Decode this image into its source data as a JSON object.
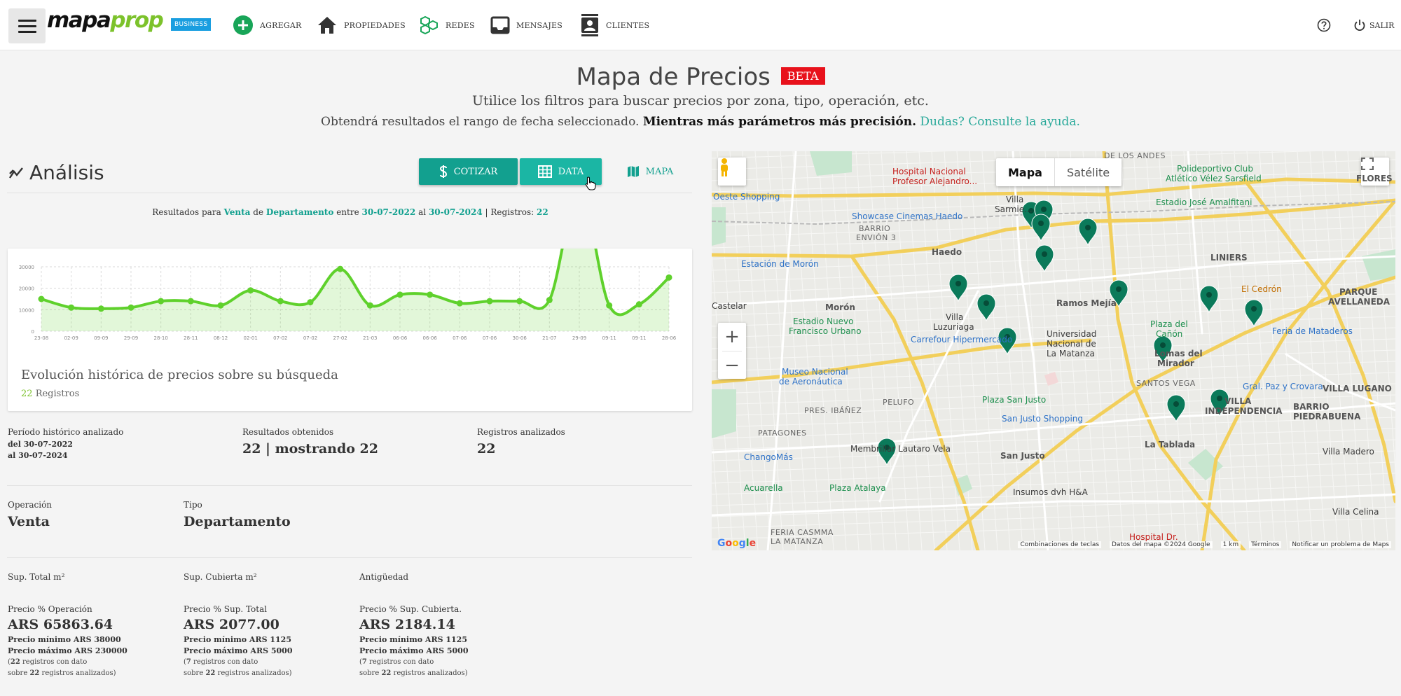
{
  "nav": {
    "logo_part1": "mapa",
    "logo_part2": "prop",
    "business_badge": "BUSINESS",
    "items": [
      {
        "label": "AGREGAR",
        "icon": "plus-circle-icon"
      },
      {
        "label": "PROPIEDADES",
        "icon": "home-icon"
      },
      {
        "label": "REDES",
        "icon": "network-icon"
      },
      {
        "label": "MENSAJES",
        "icon": "inbox-icon"
      },
      {
        "label": "CLIENTES",
        "icon": "contacts-icon"
      }
    ],
    "help_icon": "help-circle-icon",
    "logout_label": "SALIR",
    "logout_icon": "power-icon",
    "accent": "#7cc22b",
    "badge_color": "#1a9ee0"
  },
  "header": {
    "title": "Mapa de Precios",
    "beta": "BETA",
    "subtitle": "Utilice los filtros para buscar precios por zona, tipo, operación, etc.",
    "line2_plain": "Obtendrá resultados el rango de fecha seleccionado.",
    "line2_bold": "Mientras más parámetros más precisión.",
    "line2_link": "Dudas? Consulte la ayuda."
  },
  "analysis": {
    "title": "Análisis",
    "buttons": {
      "cotizar": "COTIZAR",
      "data": "DATA",
      "mapa": "MAPA"
    },
    "results": {
      "prefix": "Resultados para",
      "operation": "Venta",
      "de": "de",
      "type": "Departamento",
      "entre": "entre",
      "from": "30-07-2022",
      "al": "al",
      "to": "30-07-2024",
      "registros_label": "| Registros:",
      "registros": "22"
    },
    "card": {
      "title": "Evolución histórica de precios sobre su búsqueda",
      "count": "22",
      "count_label": "Registros"
    },
    "periodo": {
      "label": "Período histórico analizado",
      "from": "del 30-07-2022",
      "to": "al 30-07-2024"
    },
    "resultados": {
      "label": "Resultados obtenidos",
      "value": "22 | mostrando 22"
    },
    "registros": {
      "label": "Registros analizados",
      "value": "22"
    },
    "operacion": {
      "label": "Operación",
      "value": "Venta"
    },
    "tipo": {
      "label": "Tipo",
      "value": "Departamento"
    },
    "sup_total": {
      "label": "Sup. Total m²"
    },
    "sup_cubierta": {
      "label": "Sup. Cubierta m²"
    },
    "antiguedad": {
      "label": "Antigüedad"
    },
    "precio_op": {
      "label": "Precio % Operación",
      "value": "ARS 65863.64",
      "min": "Precio mínimo ARS 38000",
      "max": "Precio máximo ARS 230000",
      "note_open": "(",
      "note_count": "22",
      "note_mid": " registros con dato",
      "note_line2_a": "sobre ",
      "note_total": "22",
      "note_line2_b": " registros analizados)"
    },
    "precio_total": {
      "label": "Precio % Sup. Total",
      "value": "ARS 2077.00",
      "min": "Precio mínimo ARS 1125",
      "max": "Precio máximo ARS 5000",
      "note_open": "(",
      "note_count": "7",
      "note_mid": " registros con dato",
      "note_line2_a": "sobre ",
      "note_total": "22",
      "note_line2_b": " registros analizados)"
    },
    "precio_cubierta": {
      "label": "Precio % Sup. Cubierta.",
      "value": "ARS 2184.14",
      "min": "Precio mínimo ARS 1125",
      "max": "Precio máximo ARS 5000",
      "note_open": "(",
      "note_count": "7",
      "note_mid": " registros con dato",
      "note_line2_a": "sobre ",
      "note_total": "22",
      "note_line2_b": " registros analizados)"
    }
  },
  "chart_data": {
    "type": "area",
    "title": "",
    "x": [
      "23-08",
      "02-09",
      "09-09",
      "29-09",
      "28-10",
      "28-11",
      "08-12",
      "02-01",
      "07-02",
      "07-02",
      "27-02",
      "21-03",
      "06-06",
      "06-06",
      "07-06",
      "07-06",
      "30-06",
      "21-07",
      "29-09",
      "09-11",
      "09-11",
      "28-06"
    ],
    "values": [
      15000,
      11000,
      10500,
      11000,
      14000,
      14000,
      12000,
      19000,
      14000,
      13500,
      29000,
      12000,
      17000,
      17000,
      13000,
      14000,
      14000,
      14500,
      66000,
      12000,
      12500,
      25000
    ],
    "ylim": [
      0,
      30000
    ],
    "yticks": [
      0,
      10000,
      20000,
      30000
    ],
    "grid": true,
    "color": "#5fd12c"
  },
  "map": {
    "toggle": {
      "map": "Mapa",
      "satellite": "Satélite"
    },
    "zoom_in": "+",
    "zoom_out": "−",
    "labels": [
      {
        "text": "Hospital Nacional",
        "cls": "poi-red"
      },
      {
        "text": "Profesor Alejandro...",
        "cls": "poi-red"
      },
      {
        "text": "DE LOS ANDES",
        "cls": "area"
      },
      {
        "text": "Polideportivo Club",
        "cls": "poi-green"
      },
      {
        "text": "Atlético Vélez Sarsfield",
        "cls": "poi-green"
      },
      {
        "text": "FLORES",
        "cls": "bold"
      },
      {
        "text": "Oeste Shopping",
        "cls": "poi-blue"
      },
      {
        "text": "Villa",
        "cls": ""
      },
      {
        "text": "Sarmie...",
        "cls": ""
      },
      {
        "text": "Estadio José Amalfitani",
        "cls": "poi-green"
      },
      {
        "text": "Showcase Cinemas Haedo",
        "cls": "poi-blue"
      },
      {
        "text": "BARRIO",
        "cls": "area"
      },
      {
        "text": "ENVIÓN 3",
        "cls": "area"
      },
      {
        "text": "Haedo",
        "cls": "bold"
      },
      {
        "text": "LINIERS",
        "cls": "bold"
      },
      {
        "text": "Estación de Morón",
        "cls": "poi-blue"
      },
      {
        "text": "El Cedrón",
        "cls": "poi-orange"
      },
      {
        "text": "PARQUE",
        "cls": "bold"
      },
      {
        "text": "AVELLANEDA",
        "cls": "bold"
      },
      {
        "text": "Castelar",
        "cls": ""
      },
      {
        "text": "Morón",
        "cls": "bold"
      },
      {
        "text": "Ramos Mejía",
        "cls": "bold"
      },
      {
        "text": "Villa",
        "cls": ""
      },
      {
        "text": "Luzuriaga",
        "cls": ""
      },
      {
        "text": "Estadio Nuevo",
        "cls": "poi-green"
      },
      {
        "text": "Francisco Urbano",
        "cls": "poi-green"
      },
      {
        "text": "Carrefour Hipermercado",
        "cls": "poi-blue"
      },
      {
        "text": "Universidad",
        "cls": ""
      },
      {
        "text": "Nacional de",
        "cls": ""
      },
      {
        "text": "La Matanza",
        "cls": ""
      },
      {
        "text": "Plaza del",
        "cls": "poi-green"
      },
      {
        "text": "Cañón",
        "cls": "poi-green"
      },
      {
        "text": "Lomas del",
        "cls": "bold"
      },
      {
        "text": "Mirador",
        "cls": "bold"
      },
      {
        "text": "Feria de Mataderos",
        "cls": "poi-blue"
      },
      {
        "text": "Museo Nacional",
        "cls": "poi-blue"
      },
      {
        "text": "de Aeronáutica",
        "cls": "poi-blue"
      },
      {
        "text": "SANTOS VEGA",
        "cls": "area"
      },
      {
        "text": "Gral. Paz y Crovara",
        "cls": "poi-blue"
      },
      {
        "text": "VILLA LUGANO",
        "cls": "bold"
      },
      {
        "text": "PRES. IBÁÑEZ",
        "cls": "area"
      },
      {
        "text": "PELUFO",
        "cls": "area"
      },
      {
        "text": "Plaza San Justo",
        "cls": "poi-green"
      },
      {
        "text": "San Justo Shopping",
        "cls": "poi-blue"
      },
      {
        "text": "VILLA",
        "cls": "bold"
      },
      {
        "text": "INDEPENDENCIA",
        "cls": "bold"
      },
      {
        "text": "BARRIO",
        "cls": "bold"
      },
      {
        "text": "PIEDRABUENA",
        "cls": "bold"
      },
      {
        "text": "PATAGONES",
        "cls": "area"
      },
      {
        "text": "ChangoMás",
        "cls": "poi-blue"
      },
      {
        "text": "Membrillar Lautaro Vela",
        "cls": ""
      },
      {
        "text": "San Justo",
        "cls": "bold"
      },
      {
        "text": "La Tablada",
        "cls": "bold"
      },
      {
        "text": "Villa Madero",
        "cls": ""
      },
      {
        "text": "Acuarella",
        "cls": "poi-green"
      },
      {
        "text": "Plaza Atalaya",
        "cls": "poi-green"
      },
      {
        "text": "Insumos dvh H&A",
        "cls": ""
      },
      {
        "text": "Villa Celina",
        "cls": ""
      },
      {
        "text": "FERIA CASMMA",
        "cls": "area"
      },
      {
        "text": "LA MATANZA",
        "cls": "area"
      },
      {
        "text": "Hospital Dr.",
        "cls": "poi-red"
      }
    ],
    "footer": [
      "Combinaciones de teclas",
      "Datos del mapa ©2024 Google",
      "1 km",
      "Términos",
      "Notificar un problema de Maps"
    ],
    "google": "Google",
    "pin_color": "#0b7a5a"
  }
}
